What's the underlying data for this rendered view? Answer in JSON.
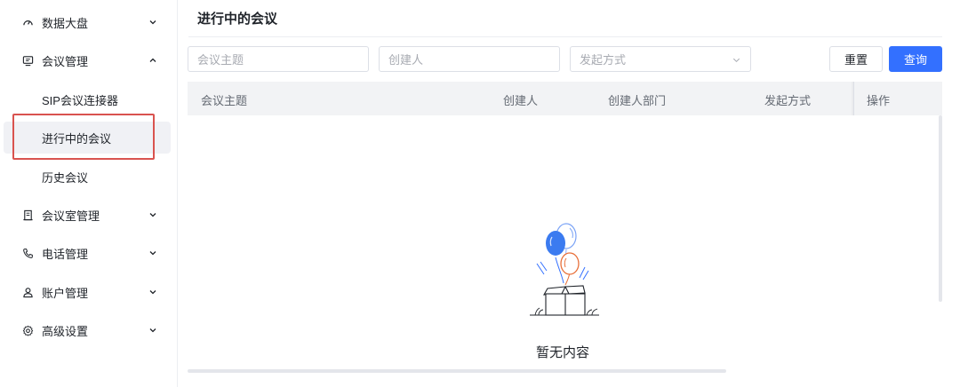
{
  "sidebar": {
    "items": [
      {
        "label": "数据大盘",
        "icon": "dashboard-icon",
        "expanded": false
      },
      {
        "label": "会议管理",
        "icon": "monitor-icon",
        "expanded": true,
        "children": [
          {
            "label": "SIP会议连接器",
            "active": false
          },
          {
            "label": "进行中的会议",
            "active": true
          },
          {
            "label": "历史会议",
            "active": false
          }
        ]
      },
      {
        "label": "会议室管理",
        "icon": "building-icon",
        "expanded": false
      },
      {
        "label": "电话管理",
        "icon": "phone-icon",
        "expanded": false
      },
      {
        "label": "账户管理",
        "icon": "user-icon",
        "expanded": false
      },
      {
        "label": "高级设置",
        "icon": "gear-icon",
        "expanded": false
      }
    ]
  },
  "main": {
    "title": "进行中的会议",
    "filters": {
      "topic_placeholder": "会议主题",
      "creator_placeholder": "创建人",
      "method_placeholder": "发起方式"
    },
    "buttons": {
      "reset": "重置",
      "search": "查询"
    },
    "table": {
      "columns": [
        "会议主题",
        "创建人",
        "创建人部门",
        "发起方式",
        "操作"
      ],
      "rows": []
    },
    "empty_text": "暂无内容"
  },
  "colors": {
    "primary": "#3370ff",
    "highlight_box": "#d9534f",
    "active_bg": "#f0f1f5",
    "header_bg": "#f2f3f5"
  }
}
